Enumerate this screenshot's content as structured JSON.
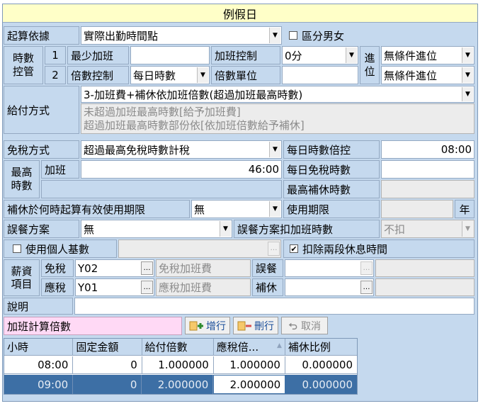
{
  "title": "例假日",
  "row1": {
    "label": "起算依據",
    "value": "實際出勤時間點",
    "gender_label": "區分男女",
    "gender_checked": false
  },
  "hours": {
    "group_label": "時數控管",
    "row1": {
      "index": "1",
      "label": "最少加班",
      "value": "",
      "ot_label": "加班控制",
      "ot_value": "0分"
    },
    "row2": {
      "index": "2",
      "label": "倍數控制",
      "value": "每日時數",
      "unit_label": "倍數單位",
      "unit_value": ""
    },
    "round_label": "進位",
    "round1": "無條件進位",
    "round2": "無條件進位"
  },
  "pay": {
    "label": "給付方式",
    "value": "3-加班費+補休依加班倍數(超過加班最高時數)",
    "desc1": "未超過加班最高時數[給予加班費]",
    "desc2": "超過加班最高時數部份依[依加班倍數給予補休]"
  },
  "tax": {
    "label": "免稅方式",
    "value": "超過最高免稅時數計稅",
    "daily_ctrl_label": "每日時數倍控",
    "daily_ctrl_value": "08:00",
    "max_label": "最高時數",
    "ot_label": "加班",
    "ot_value": "46:00",
    "daily_free_label": "每日免稅時數",
    "daily_free_value": "",
    "max_comp_label": "最高補休時數",
    "max_comp_value": ""
  },
  "comp": {
    "label": "補休於何時起算有效使用期限",
    "value": "無",
    "period_label": "使用期限",
    "period_value": "",
    "period_unit": "年"
  },
  "meal": {
    "label": "誤餐方案",
    "value": "無",
    "deduct_label": "誤餐方案扣加班時數",
    "deduct_value": "不扣"
  },
  "personal": {
    "label": "使用個人基數",
    "checked": false,
    "value": "",
    "break_label": "扣除兩段休息時間",
    "break_checked": true
  },
  "salary": {
    "group_label": "薪資項目",
    "free_label": "免稅",
    "free_value": "Y02",
    "free_ot_label": "免稅加班費",
    "free_ot_value": "",
    "meal_label": "誤餐",
    "meal_value": "",
    "taxed_label": "應稅",
    "taxed_value": "Y01",
    "taxed_ot_label": "應稅加班費",
    "taxed_ot_value": "",
    "comp_label": "補休",
    "comp_value": ""
  },
  "note": {
    "label": "說明",
    "value": ""
  },
  "calc": {
    "label": "加班計算倍數",
    "add_label": "增行",
    "del_label": "刪行",
    "cancel_label": "取消"
  },
  "table": {
    "headers": [
      "小時",
      "固定金額",
      "給付倍數",
      "應稅倍...",
      "補休比例"
    ],
    "rows": [
      [
        "08:00",
        "0",
        "1.000000",
        "1.000000",
        "0.000000"
      ],
      [
        "09:00",
        "0",
        "2.000000",
        "2.000000",
        "0.000000"
      ]
    ]
  },
  "colors": {
    "label_bg": "#c5d9ee",
    "title_bg": "#ffffc8",
    "selected_row": "#3d6fa5",
    "calc_label_bg": "#ffd9f5"
  }
}
